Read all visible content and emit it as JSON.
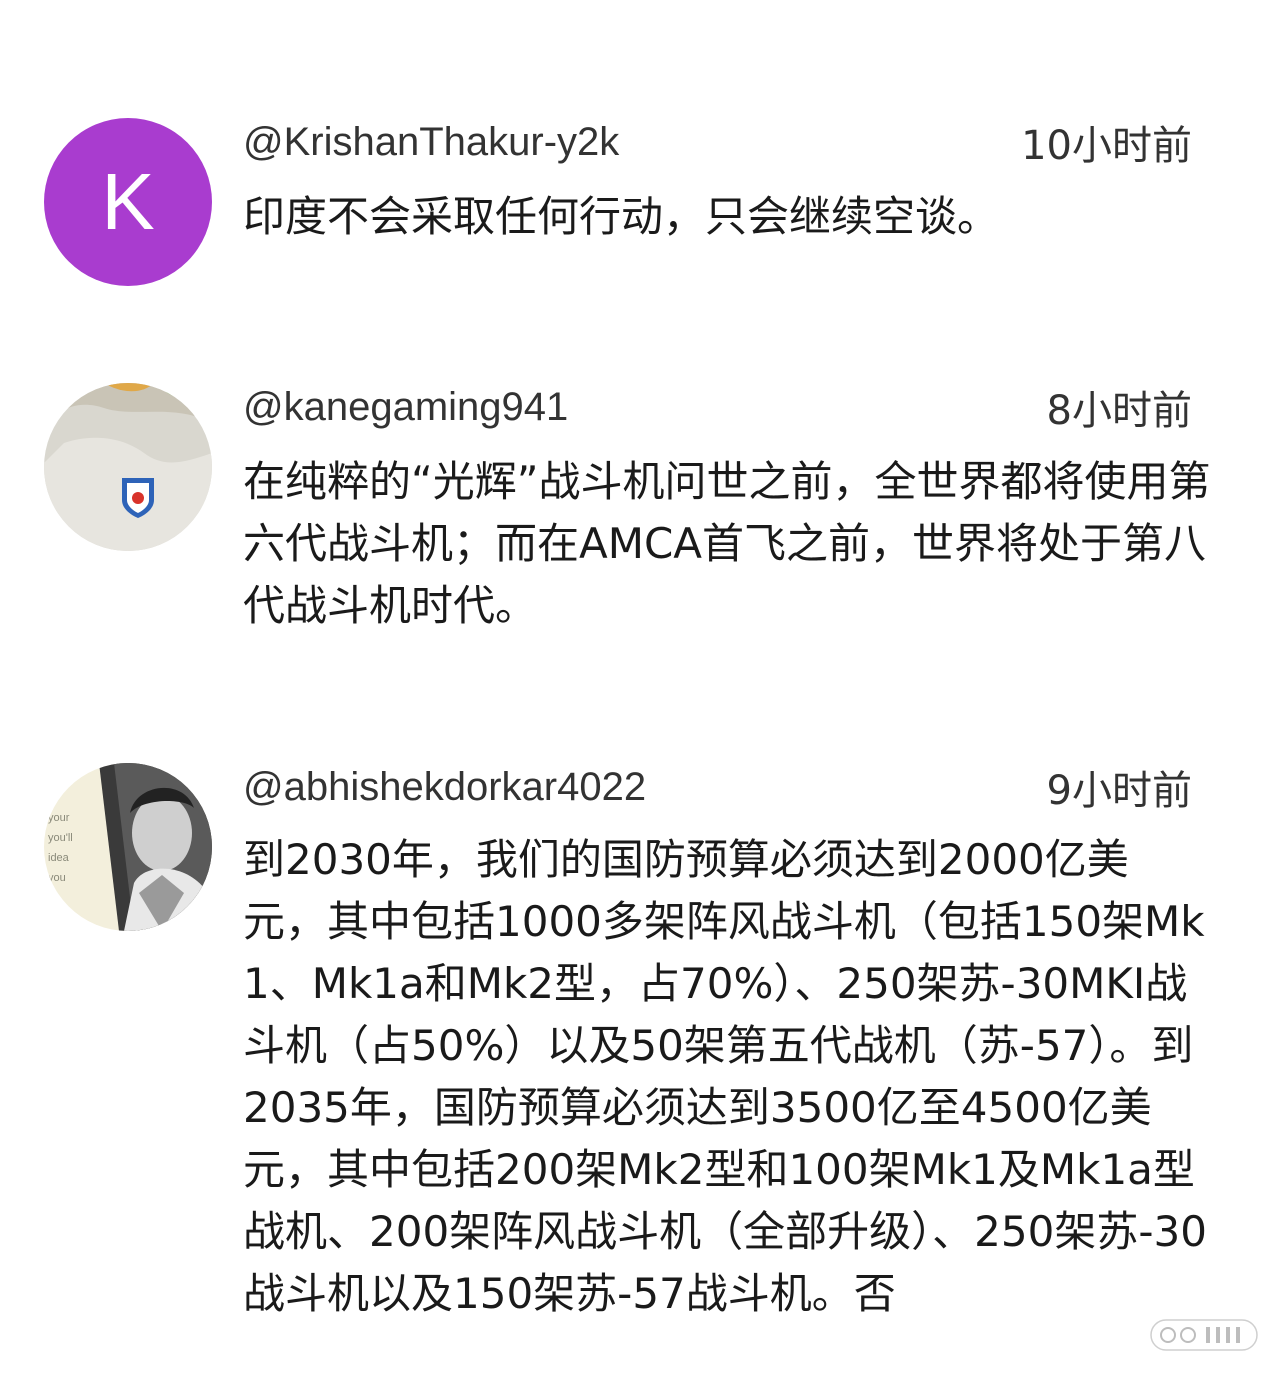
{
  "comments": [
    {
      "author": "@KrishanThakur-y2k",
      "time": "10小时前",
      "avatar_letter": "K",
      "avatar_color": "#a93ccf",
      "text": "印度不会采取任何行动，只会继续空谈。"
    },
    {
      "author": "@kanegaming941",
      "time": "8小时前",
      "text": "在纯粹的“光辉”战斗机问世之前，全世界都将使用第六代战斗机；而在AMCA首飞之前，世界将处于第八代战斗机时代。"
    },
    {
      "author": "@abhishekdorkar4022",
      "time": "9小时前",
      "text": "到2030年，我们的国防预算必须达到2000亿美元，其中包括1000多架阵风战斗机（包括150架Mk1、Mk1a和Mk2型，占70%）、250架苏-30MKI战斗机（占50%）以及50架第五代战机（苏-57）。到2035年，国防预算必须达到3500亿至4500亿美元，其中包括200架Mk2型和100架Mk1及Mk1a型战机、200架阵风战斗机（全部升级）、250架苏-30战斗机以及150架苏-57战斗机。否"
    }
  ],
  "watermark_icon": "weibo-watermark-icon"
}
